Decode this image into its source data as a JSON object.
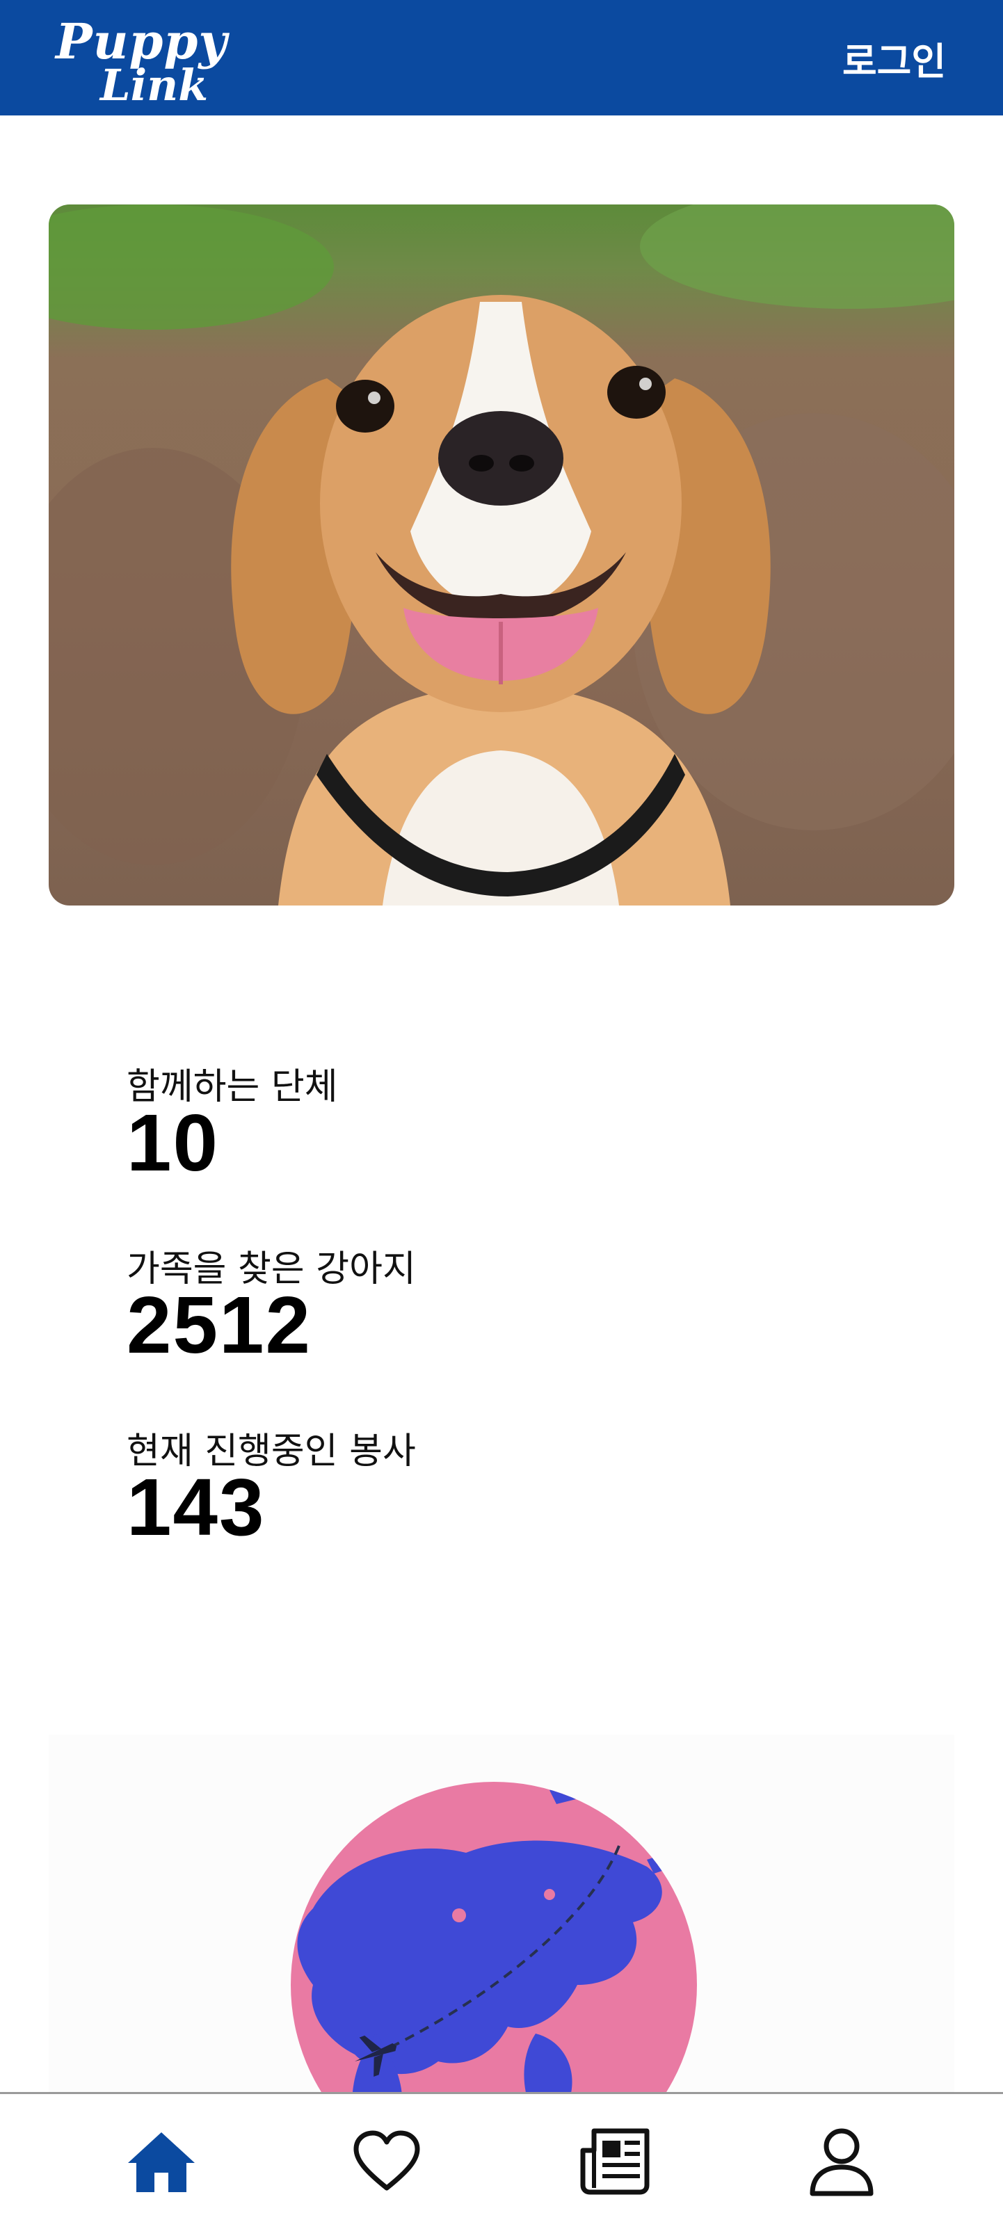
{
  "header": {
    "logo_line1": "Puppy",
    "logo_line2": "Link",
    "login_label": "로그인",
    "brand_color": "#0b4aa0"
  },
  "hero": {
    "image": "beagle-dog-photo"
  },
  "stats": [
    {
      "label": "함께하는 단체",
      "value": "10"
    },
    {
      "label": "가족을 찾은 강아지",
      "value": "2512"
    },
    {
      "label": "현재 진행중인 봉사",
      "value": "143"
    }
  ],
  "illustration": {
    "image": "globe-with-airplane",
    "colors": {
      "globe": "#e97aa3",
      "land": "#3f49d6"
    }
  },
  "bottom_nav": {
    "items": [
      {
        "icon": "home-icon",
        "active": true
      },
      {
        "icon": "heart-icon",
        "active": false
      },
      {
        "icon": "newspaper-icon",
        "active": false
      },
      {
        "icon": "user-icon",
        "active": false
      }
    ],
    "active_color": "#0b4aa0",
    "inactive_color": "#111111"
  }
}
